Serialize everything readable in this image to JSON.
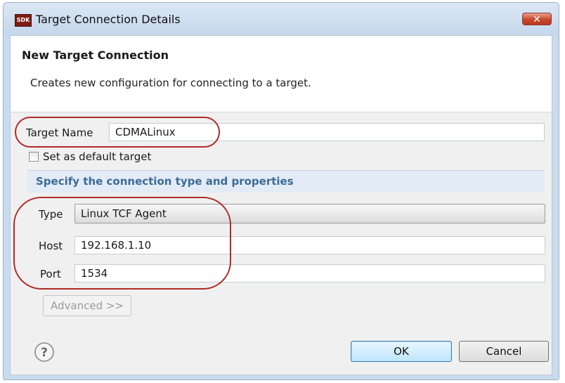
{
  "window": {
    "title": "Target Connection Details",
    "app_icon_text": "SDK",
    "close_glyph": "✕"
  },
  "header": {
    "title": "New Target Connection",
    "description": "Creates new configuration for connecting to a target."
  },
  "form": {
    "target_name_label": "Target Name",
    "target_name_value": "CDMALinux",
    "default_checkbox_label": "Set as default target",
    "default_checkbox_checked": false,
    "section_title": "Specify the connection type and properties",
    "type_label": "Type",
    "type_value": "Linux TCF Agent",
    "host_label": "Host",
    "host_value": "192.168.1.10",
    "port_label": "Port",
    "port_value": "1534",
    "advanced_button": "Advanced >>"
  },
  "buttons": {
    "ok": "OK",
    "cancel": "Cancel",
    "help_glyph": "?"
  },
  "colors": {
    "annotation": "#b02a2a",
    "section_title": "#3d6c95",
    "ok_border": "#3c7fb1"
  },
  "icons": [
    "sdk-app-icon",
    "close-icon",
    "chevron-down-icon",
    "help-icon"
  ]
}
